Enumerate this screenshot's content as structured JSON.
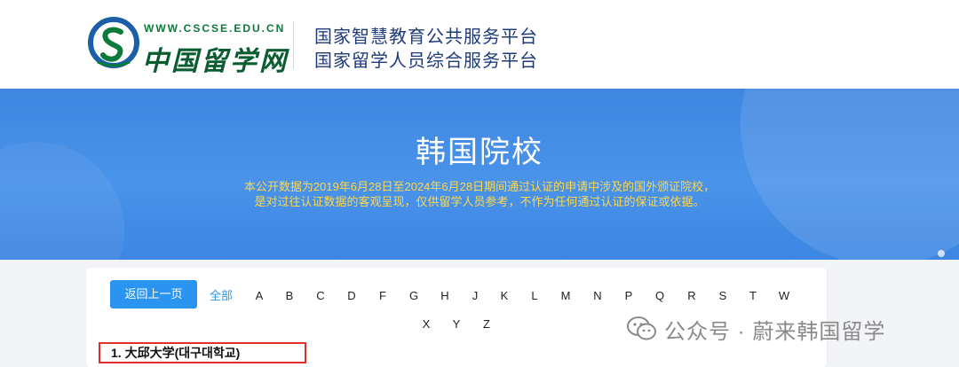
{
  "header": {
    "logo_url": "WWW.CSCSE.EDU.CN",
    "logo_name": "中国留学网",
    "platform_line1": "国家智慧教育公共服务平台",
    "platform_line2": "国家留学人员综合服务平台"
  },
  "banner": {
    "title": "韩国院校",
    "desc_line1": "本公开数据为2019年6月28日至2024年6月28日期间通过认证的申请中涉及的国外颁证院校，",
    "desc_line2": "是对过往认证数据的客观呈现，仅供留学人员参考，不作为任何通过认证的保证或依据。"
  },
  "nav": {
    "back_label": "返回上一页",
    "all_label": "全部",
    "letters_row1": [
      "A",
      "B",
      "C",
      "D",
      "F",
      "G",
      "H",
      "J",
      "K",
      "L",
      "M",
      "N",
      "P",
      "Q",
      "R",
      "S",
      "T",
      "W"
    ],
    "letters_row2": [
      "X",
      "Y",
      "Z"
    ]
  },
  "schools": [
    {
      "label": "1.  大邱大学(대구대학교)"
    }
  ],
  "watermark": {
    "text": "公众号 · 蔚来韩国留学",
    "icon": "wechat-icon"
  },
  "colors": {
    "banner_blue": "#4a93ea",
    "accent_blue": "#2b94f1",
    "desc_yellow": "#ffd84a",
    "highlight_red": "#e2312d",
    "brand_green": "#0b7a3a"
  }
}
